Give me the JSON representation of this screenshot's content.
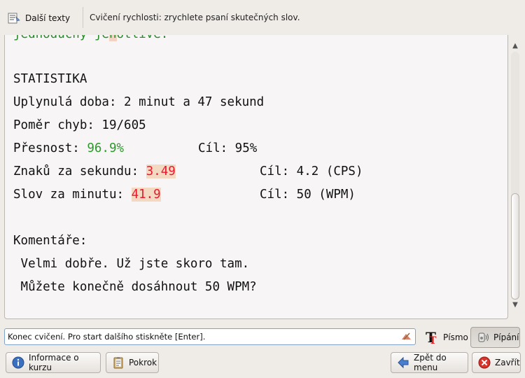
{
  "toolbar": {
    "more_texts_label": "Další texty",
    "exercise_title": "Cvičení rychlosti: zrychlete psaní skutečných slov."
  },
  "content": {
    "partial_top_line_a": "jednoduchý je",
    "partial_top_line_b": "n",
    "partial_top_line_c": "otlivé.",
    "stats_heading": "STATISTIKA",
    "elapsed": "Uplynulá doba: 2 minut a 47 sekund",
    "error_ratio": "Poměr chyb: 19/605",
    "accuracy_label": "Přesnost: ",
    "accuracy_value": "96.9%",
    "accuracy_goal": "Cíl: 95%",
    "cps_label": "Znaků za sekundu: ",
    "cps_value": "3.49",
    "cps_goal": "Cíl: 4.2 (CPS)",
    "wpm_label": "Slov za minutu: ",
    "wpm_value": "41.9",
    "wpm_goal": "Cíl: 50 (WPM)",
    "comments_heading": "Komentáře:",
    "comment_1": " Velmi dobře. Už jste skoro tam.",
    "comment_2": " Můžete konečně dosáhnout 50 WPM?"
  },
  "status": {
    "input_value": "Konec cvičení. Pro start dalšího stiskněte [Enter]."
  },
  "buttons": {
    "font": "Písmo",
    "beep": "Pípání",
    "course_info": "Informace o kurzu",
    "progress": "Pokrok",
    "back_to_menu": "Zpět do menu",
    "close": "Zavřít"
  },
  "icons": {
    "more_texts": "text-lines-icon",
    "clear": "clear-input-icon",
    "font": "font-t-icon",
    "beep": "speaker-icon",
    "info": "info-icon",
    "progress": "clipboard-icon",
    "back": "arrow-left-icon",
    "close": "close-circle-icon"
  },
  "colors": {
    "good": "#2b9a2b",
    "bad": "#e8192c",
    "bad_bg": "#f3d8c2"
  }
}
